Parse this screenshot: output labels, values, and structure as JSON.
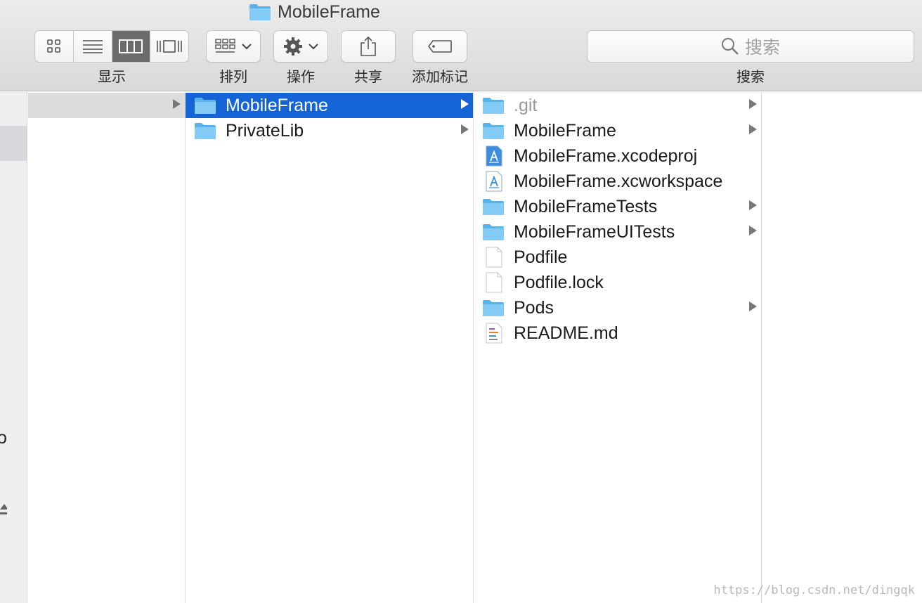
{
  "window": {
    "title": "MobileFrame",
    "title_icon": "folder-icon"
  },
  "toolbar": {
    "view_label": "显示",
    "arrange_label": "排列",
    "action_label": "操作",
    "share_label": "共享",
    "tags_label": "添加标记",
    "search_label": "搜索",
    "search_placeholder": "搜索",
    "active_view": "columns"
  },
  "sidebar": {
    "fragments": [
      "o"
    ]
  },
  "columns": [
    {
      "items": [
        {
          "name": "",
          "type": "folder",
          "has_children": true,
          "state": "parent"
        }
      ]
    },
    {
      "items": [
        {
          "name": "MobileFrame",
          "type": "folder",
          "has_children": true,
          "state": "selected"
        },
        {
          "name": "PrivateLib",
          "type": "folder",
          "has_children": true,
          "state": ""
        }
      ]
    },
    {
      "items": [
        {
          "name": ".git",
          "type": "folder",
          "has_children": true,
          "state": "dim"
        },
        {
          "name": "MobileFrame",
          "type": "folder",
          "has_children": true,
          "state": ""
        },
        {
          "name": "MobileFrame.xcodeproj",
          "type": "xcode",
          "has_children": false,
          "state": ""
        },
        {
          "name": "MobileFrame.xcworkspace",
          "type": "xcworkspace",
          "has_children": false,
          "state": ""
        },
        {
          "name": "MobileFrameTests",
          "type": "folder",
          "has_children": true,
          "state": ""
        },
        {
          "name": "MobileFrameUITests",
          "type": "folder",
          "has_children": true,
          "state": ""
        },
        {
          "name": "Podfile",
          "type": "document",
          "has_children": false,
          "state": ""
        },
        {
          "name": "Podfile.lock",
          "type": "document",
          "has_children": false,
          "state": ""
        },
        {
          "name": "Pods",
          "type": "folder",
          "has_children": true,
          "state": ""
        },
        {
          "name": "README.md",
          "type": "markdown",
          "has_children": false,
          "state": ""
        }
      ]
    }
  ],
  "watermark": "https://blog.csdn.net/dingqk",
  "colors": {
    "selection": "#1464d6",
    "folder": "#6cc2f4",
    "toolbar": "#e3e3e3"
  }
}
